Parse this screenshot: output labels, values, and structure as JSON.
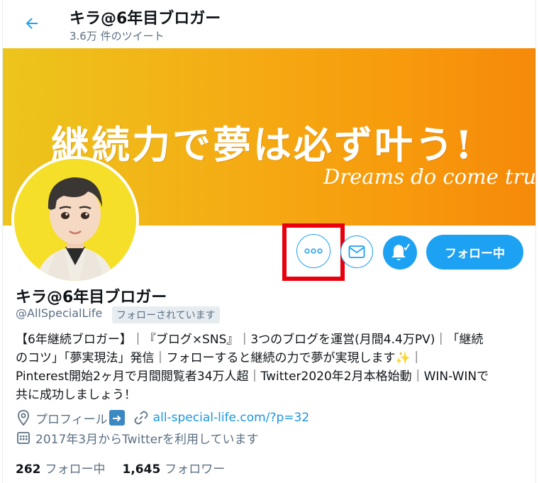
{
  "header": {
    "title": "キラ@6年目ブロガー",
    "tweet_count": "3.6万 件のツイート"
  },
  "banner": {
    "headline_jp": "継続力で夢は必ず叶う!",
    "headline_en": "Dreams do come true!"
  },
  "actions": {
    "more_icon": "more-dots-icon",
    "dm_icon": "envelope-icon",
    "bell_icon": "bell-icon",
    "follow_label": "フォロー中"
  },
  "profile": {
    "name": "キラ@6年目ブロガー",
    "handle": "@AllSpecialLife",
    "follows_you": "フォローされています",
    "bio_lines": [
      "【6年継続ブロガー】｜『ブログ×SNS』｜3つのブログを運営(月間4.4万PV)｜「継続",
      "のコツ」「夢実現法」発信｜フォローすると継続の力で夢が実現します",
      "Pinterest開始2ヶ月で月間閲覧者34万人超｜Twitter2020年2月本格始動｜WIN-WINで",
      "共に成功しましょう！"
    ],
    "bio_sparkle_tail": "｜",
    "location": "プロフィール",
    "url": "all-special-life.com/?p=32",
    "joined": "2017年3月からTwitterを利用しています"
  },
  "stats": {
    "following_count": "262",
    "following_label": "フォロー中",
    "followers_count": "1,645",
    "followers_label": "フォロワー"
  },
  "colors": {
    "accent": "#1da1f2",
    "highlight": "#e8000c",
    "banner_start": "#ecc51c",
    "banner_end": "#f6890a"
  }
}
